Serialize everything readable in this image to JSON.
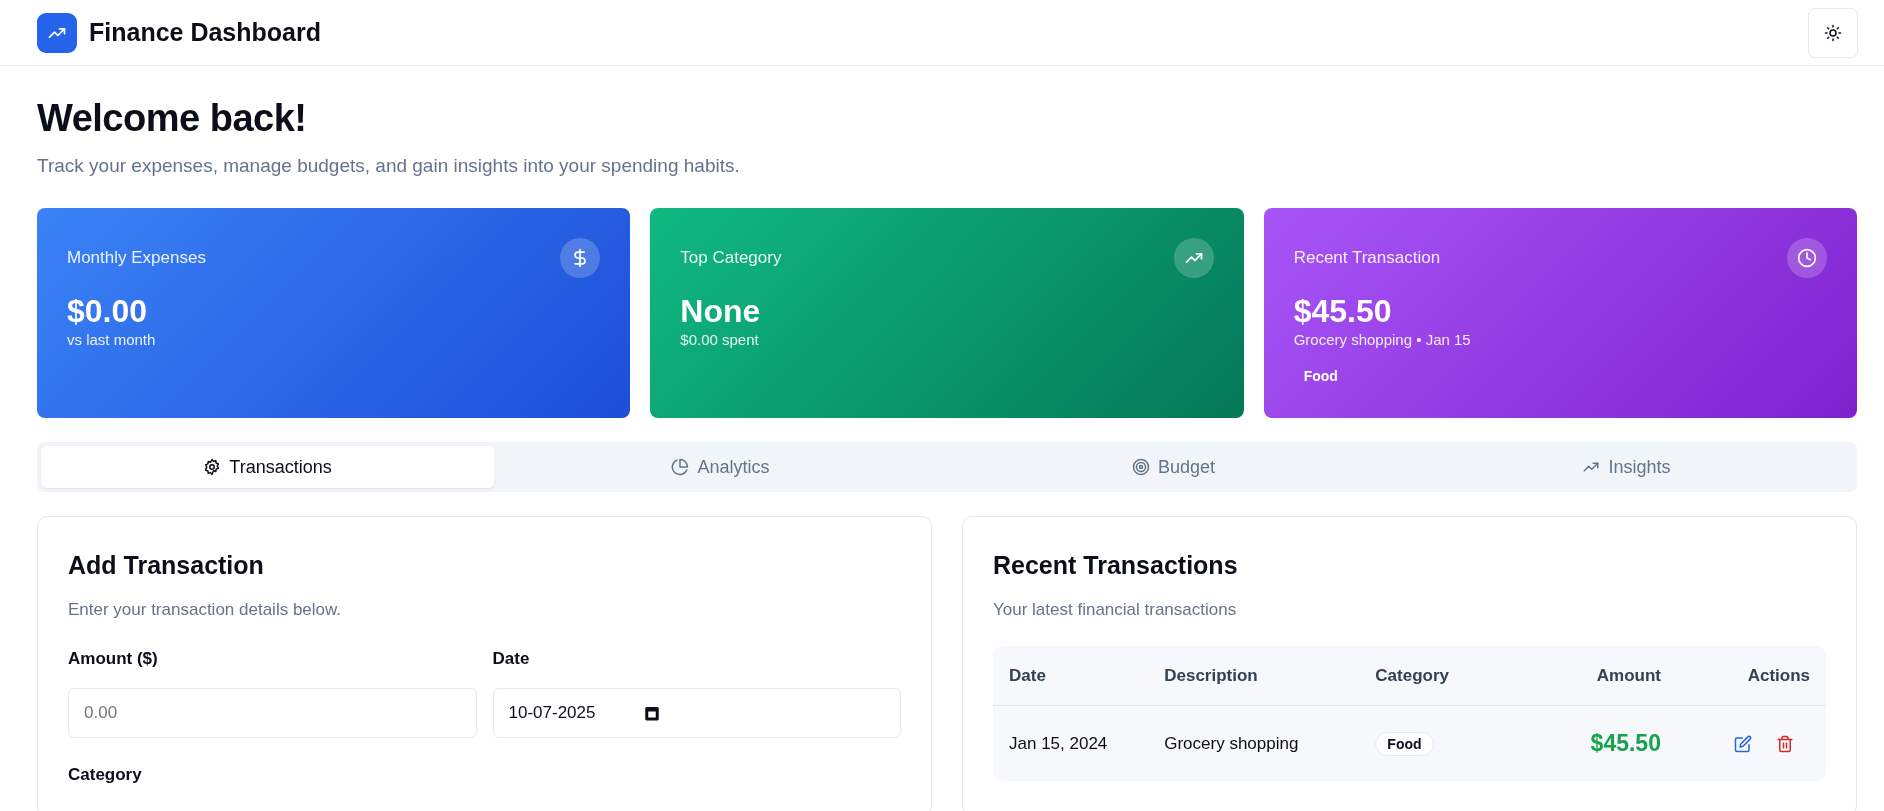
{
  "header": {
    "title": "Finance Dashboard"
  },
  "welcome": {
    "title": "Welcome back!",
    "subtitle": "Track your expenses, manage budgets, and gain insights into your spending habits."
  },
  "stat_cards": [
    {
      "kind": "dollar",
      "label": "Monthly Expenses",
      "value": "$0.00",
      "note": "vs last month"
    },
    {
      "kind": "trend",
      "label": "Top Category",
      "value": "None",
      "note": "$0.00 spent"
    },
    {
      "kind": "clock",
      "label": "Recent Transaction",
      "value": "$45.50",
      "note": "Grocery shopping • Jan 15",
      "tag": "Food"
    }
  ],
  "tabs": [
    {
      "kind": "gear",
      "label": "Transactions",
      "selected": true
    },
    {
      "kind": "pie",
      "label": "Analytics",
      "selected": false
    },
    {
      "kind": "target",
      "label": "Budget",
      "selected": false
    },
    {
      "kind": "trend",
      "label": "Insights",
      "selected": false
    }
  ],
  "add_form": {
    "title": "Add Transaction",
    "subtitle": "Enter your transaction details below.",
    "fields": [
      {
        "label": "Amount ($)",
        "placeholder": "0.00"
      },
      {
        "label": "Date",
        "value": "10-07-2025"
      }
    ],
    "category_label": "Category"
  },
  "recent": {
    "title": "Recent Transactions",
    "subtitle": "Your latest financial transactions",
    "columns": [
      "Date",
      "Description",
      "Category",
      "Amount",
      "Actions"
    ],
    "rows": [
      {
        "date": "Jan 15, 2024",
        "description": "Grocery shopping",
        "category": "Food",
        "amount": "$45.50"
      }
    ]
  }
}
